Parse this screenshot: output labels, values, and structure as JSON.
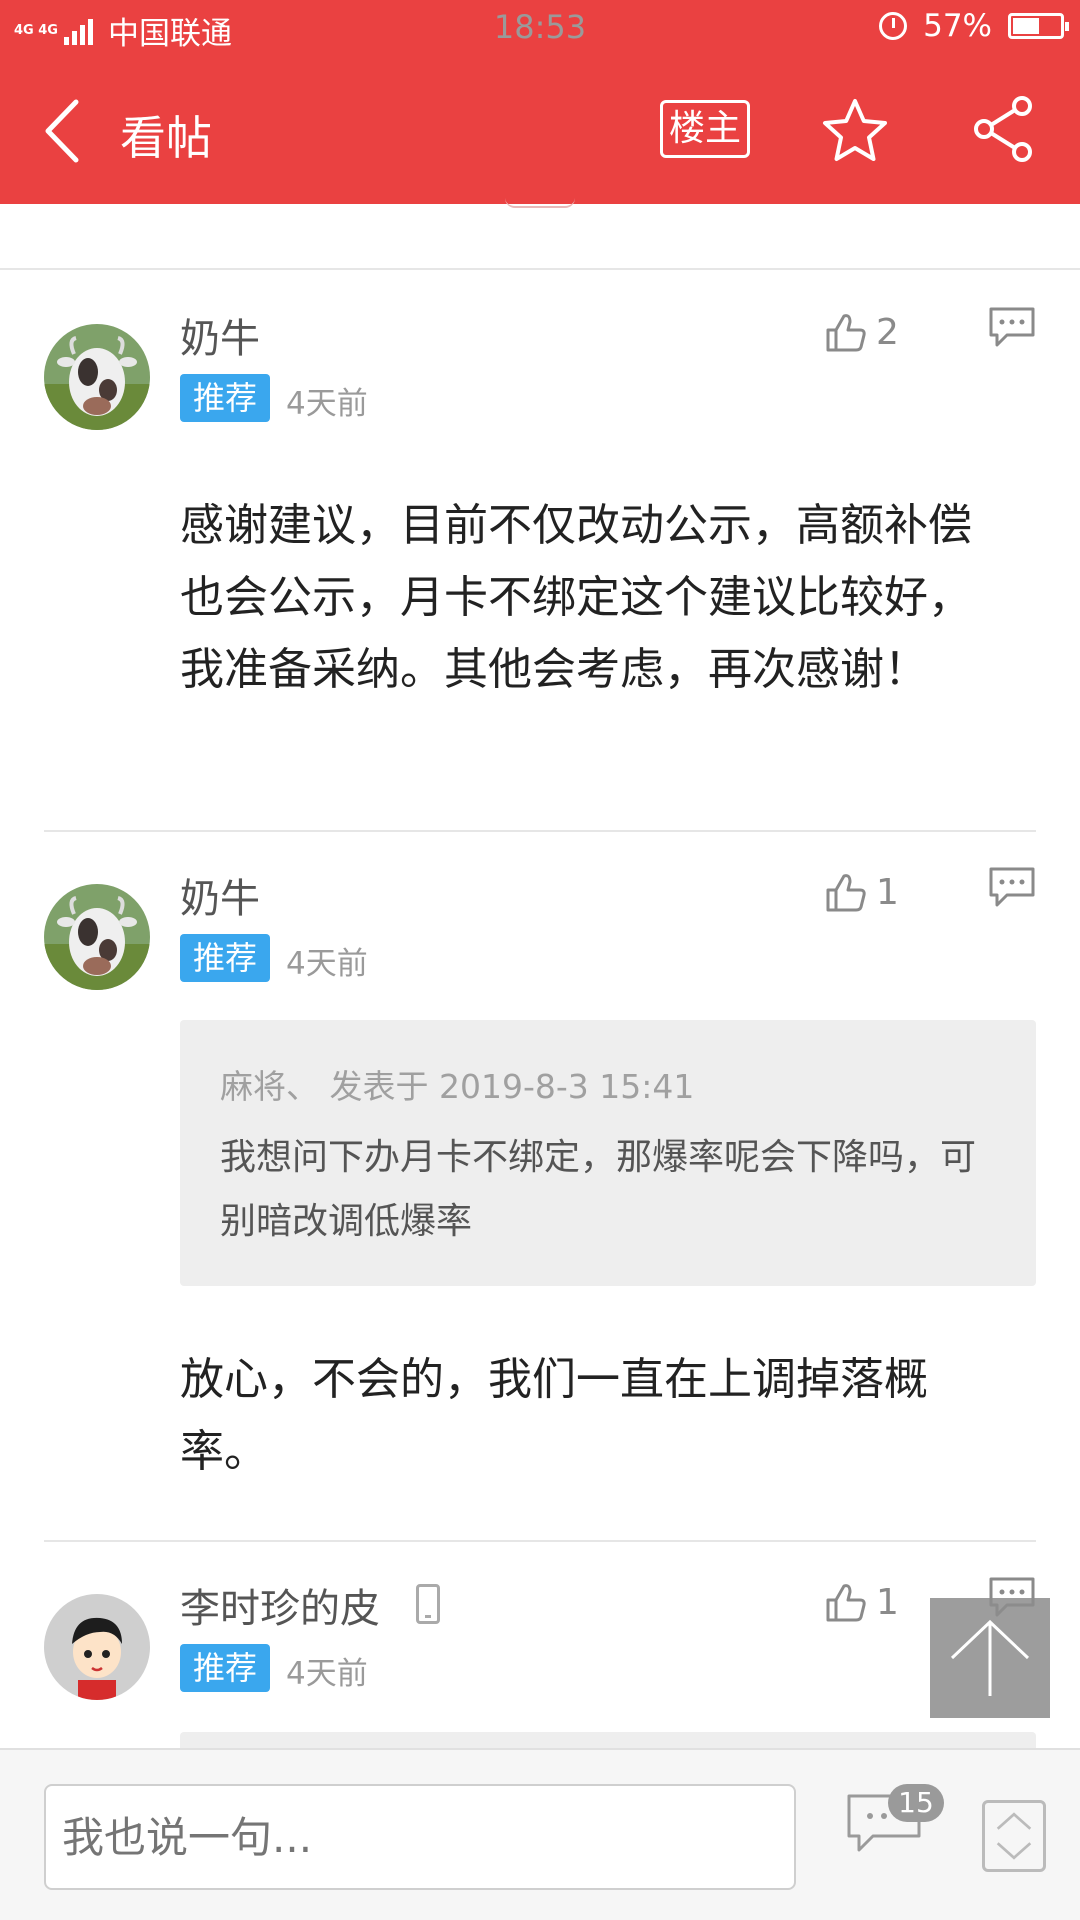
{
  "status_bar": {
    "network": "4G 4G",
    "carrier": "中国联通",
    "time": "18:53",
    "battery": "57%",
    "battery_level": 0.57
  },
  "nav": {
    "title": "看帖",
    "owner_label": "楼主"
  },
  "posts": [
    {
      "username": "奶牛",
      "tag": "推荐",
      "time": "4天前",
      "likes": "2",
      "text": "感谢建议，目前不仅改动公示，高额补偿也会公示，月卡不绑定这个建议比较好，我准备采纳。其他会考虑，再次感谢！"
    },
    {
      "username": "奶牛",
      "tag": "推荐",
      "time": "4天前",
      "likes": "1",
      "quote_header": "麻将、 发表于 2019-8-3 15:41",
      "quote_text": "我想问下办月卡不绑定，那爆率呢会下降吗，可别暗改调低爆率",
      "text": "放心，不会的，我们一直在上调掉落概率。"
    },
    {
      "username": "李时珍的皮",
      "tag": "推荐",
      "time": "4天前",
      "likes": "1"
    }
  ],
  "bottom": {
    "placeholder": "我也说一句...",
    "comment_count": "15"
  },
  "colors": {
    "brand": "#ea4141",
    "tag": "#3aa7ee"
  }
}
